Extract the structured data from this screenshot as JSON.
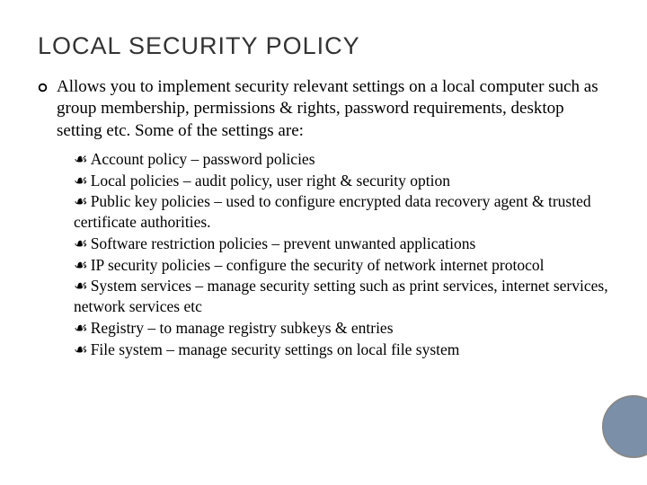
{
  "title": "LOCAL SECURITY POLICY",
  "main_bullet": "Allows you to implement security relevant settings on a local computer such as group membership, permissions & rights, password requirements, desktop setting etc. Some of the settings are:",
  "sub_glyph": "☙",
  "sub_items": [
    "Account policy – password policies",
    "Local policies – audit policy, user right & security option",
    "Public key policies – used to configure encrypted data recovery agent & trusted certificate authorities.",
    "Software restriction policies – prevent unwanted applications",
    "IP security policies – configure the security of network internet protocol",
    "System services – manage security setting such as print services, internet services, network services etc",
    "Registry – to manage registry subkeys & entries",
    "File system – manage security settings on local file system"
  ]
}
